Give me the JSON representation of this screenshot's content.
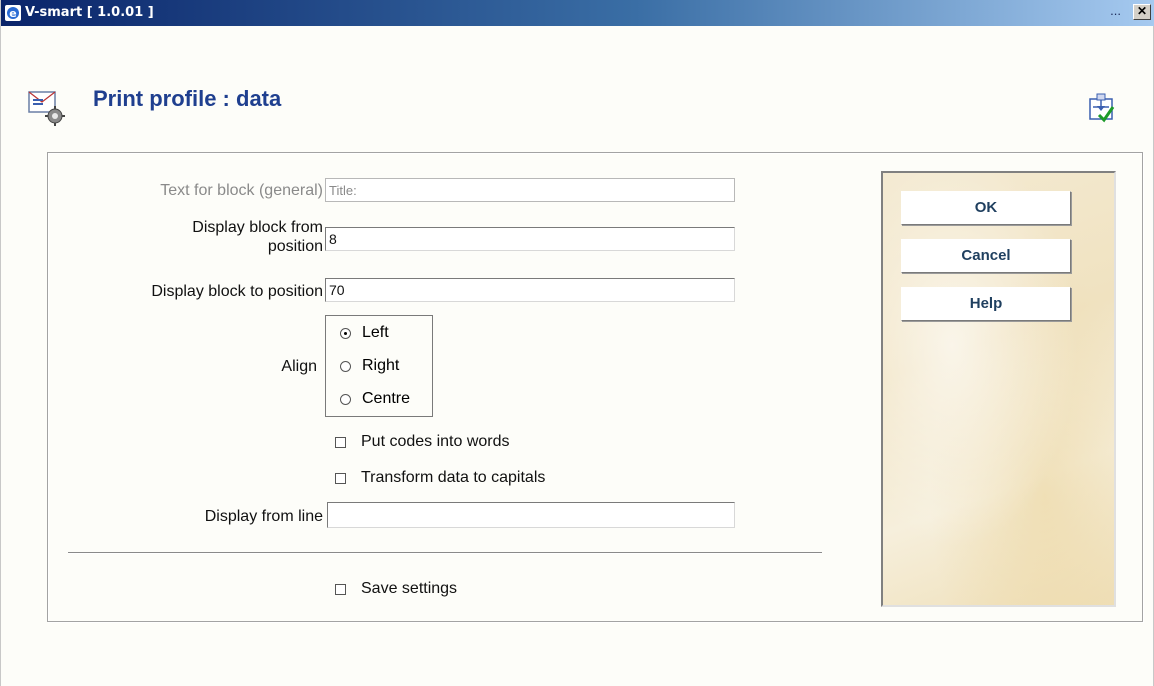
{
  "window": {
    "title": "V-smart [ 1.0.01 ]",
    "ellipsis": "...",
    "close_glyph": "✕"
  },
  "header": {
    "title": "Print profile : data",
    "icon": "print-profile-icon",
    "right_icon": "tree-check-icon"
  },
  "form": {
    "text_for_block": {
      "label": "Text for block (general)",
      "value": "Title:"
    },
    "display_from_position": {
      "label_line1": "Display block from",
      "label_line2": "position",
      "value": "8"
    },
    "display_to_position": {
      "label": "Display block to position",
      "value": "70"
    },
    "align": {
      "label": "Align",
      "options": [
        {
          "label": "Left",
          "selected": true
        },
        {
          "label": "Right",
          "selected": false
        },
        {
          "label": "Centre",
          "selected": false
        }
      ]
    },
    "put_codes_into_words": {
      "label": "Put codes into words",
      "checked": false
    },
    "transform_to_capitals": {
      "label": "Transform data to capitals",
      "checked": false
    },
    "display_from_line": {
      "label": "Display from line",
      "value": ""
    },
    "save_settings": {
      "label": "Save settings",
      "checked": false
    }
  },
  "buttons": {
    "ok": "OK",
    "cancel": "Cancel",
    "help": "Help"
  },
  "colors": {
    "title_blue": "#1f3f8f",
    "button_text": "#1f3f5f",
    "panel_bg": "#f4ead2"
  }
}
